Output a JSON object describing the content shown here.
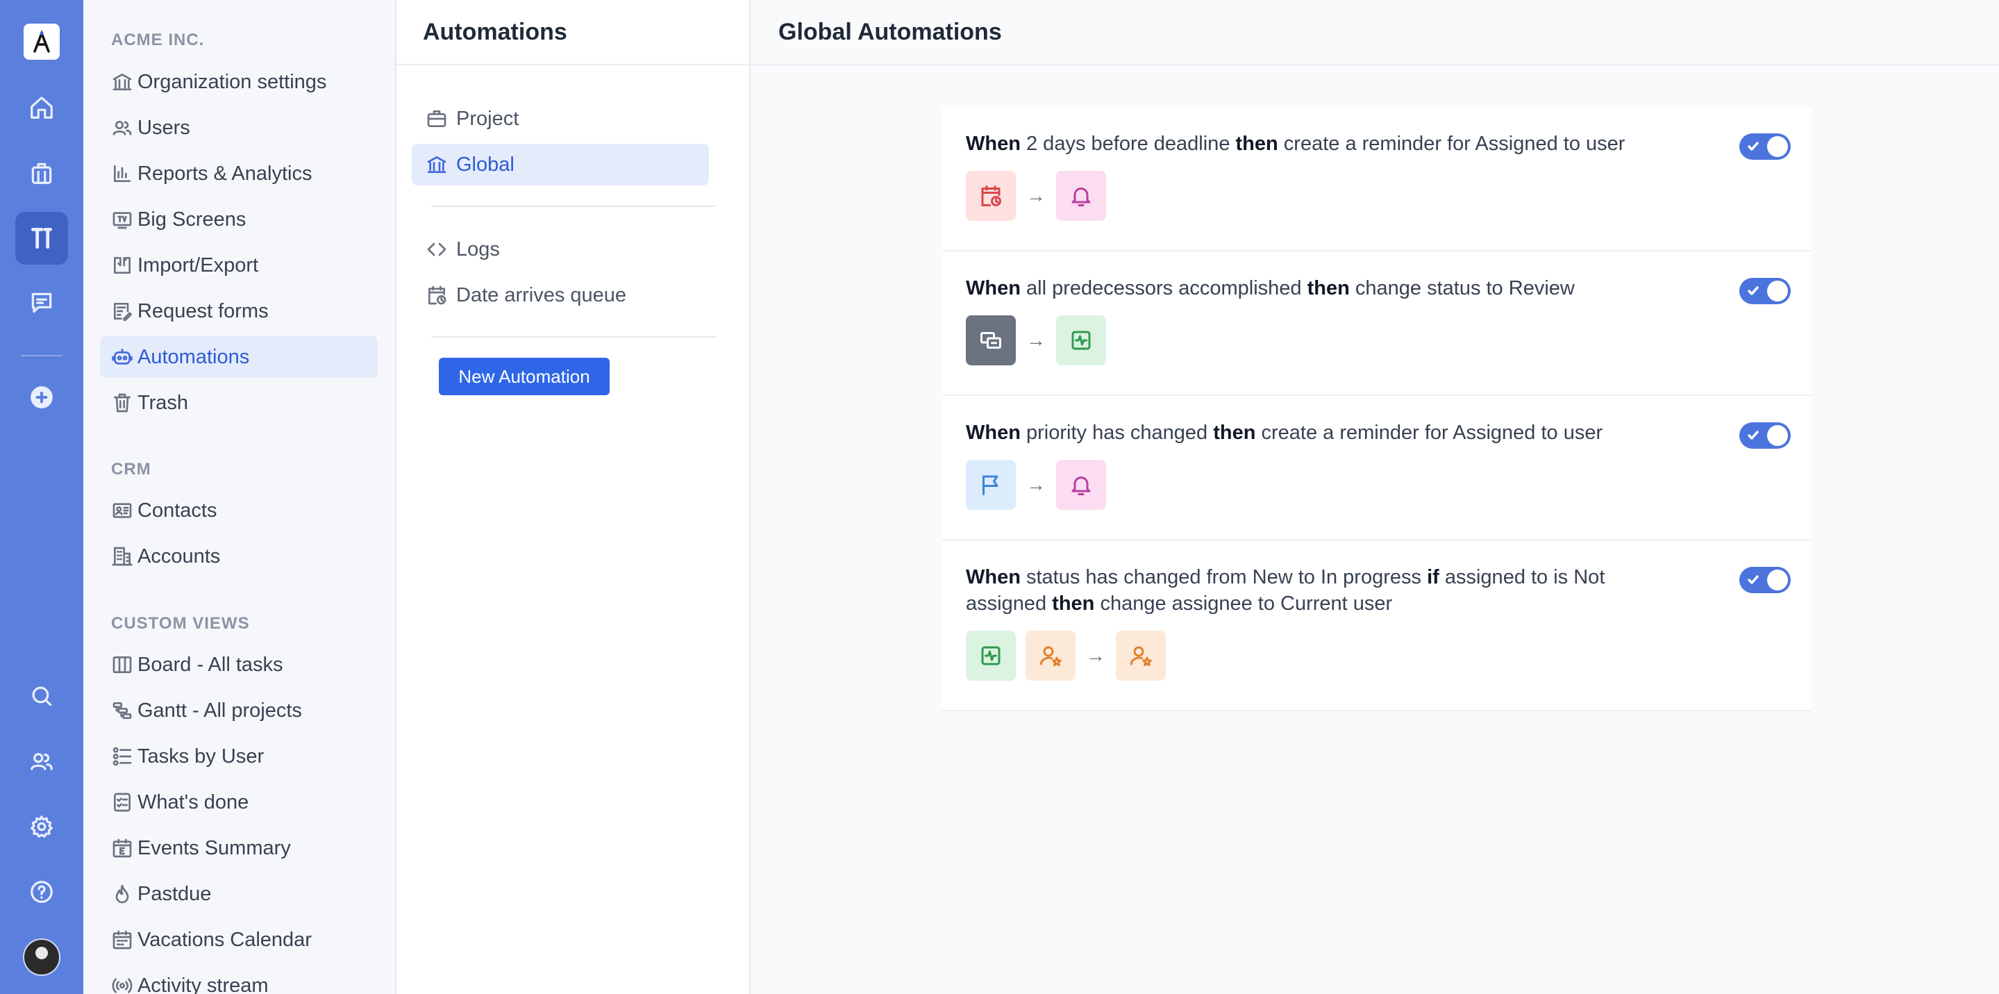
{
  "nav": {
    "section_org": "ACME INC.",
    "org_items": [
      {
        "label": "Organization settings",
        "icon": "bank-icon"
      },
      {
        "label": "Users",
        "icon": "users-icon"
      },
      {
        "label": "Reports & Analytics",
        "icon": "bar-chart-icon"
      },
      {
        "label": "Big Screens",
        "icon": "tv-icon"
      },
      {
        "label": "Import/Export",
        "icon": "import-export-icon"
      },
      {
        "label": "Request forms",
        "icon": "form-icon"
      },
      {
        "label": "Automations",
        "icon": "robot-icon",
        "active": true
      },
      {
        "label": "Trash",
        "icon": "trash-icon"
      }
    ],
    "section_crm": "CRM",
    "crm_items": [
      {
        "label": "Contacts",
        "icon": "contact-card-icon"
      },
      {
        "label": "Accounts",
        "icon": "building-icon"
      }
    ],
    "section_custom": "CUSTOM VIEWS",
    "custom_items": [
      {
        "label": "Board - All tasks",
        "icon": "board-icon"
      },
      {
        "label": "Gantt - All projects",
        "icon": "gantt-icon"
      },
      {
        "label": "Tasks by User",
        "icon": "list-users-icon"
      },
      {
        "label": "What's done",
        "icon": "checklist-icon"
      },
      {
        "label": "Events Summary",
        "icon": "calendar-e-icon"
      },
      {
        "label": "Pastdue",
        "icon": "flame-icon"
      },
      {
        "label": "Vacations Calendar",
        "icon": "calendar-icon"
      },
      {
        "label": "Activity stream",
        "icon": "broadcast-icon"
      }
    ]
  },
  "middle": {
    "title": "Automations",
    "items": [
      {
        "label": "Project",
        "icon": "briefcase-icon"
      },
      {
        "label": "Global",
        "icon": "bank-icon",
        "active": true
      },
      {
        "label": "Logs",
        "icon": "code-icon"
      },
      {
        "label": "Date arrives queue",
        "icon": "calendar-clock-icon"
      }
    ],
    "new_button": "New Automation"
  },
  "main": {
    "title": "Global Automations",
    "rules": [
      {
        "when": "When",
        "trigger": "2 days before deadline",
        "then": "then",
        "action": "create a reminder for Assigned to user",
        "enabled": true,
        "trigger_icons": [
          "calendar-clock-icon"
        ],
        "action_icons": [
          "bell-icon"
        ]
      },
      {
        "when": "When",
        "trigger": "all predecessors accomplished",
        "then": "then",
        "action": "change status to Review",
        "enabled": true,
        "trigger_icons": [
          "predecessors-icon"
        ],
        "action_icons": [
          "status-pulse-icon"
        ]
      },
      {
        "when": "When",
        "trigger": "priority has changed",
        "then": "then",
        "action": "create a reminder for Assigned to user",
        "enabled": true,
        "trigger_icons": [
          "flag-icon"
        ],
        "action_icons": [
          "bell-icon"
        ]
      },
      {
        "when": "When",
        "trigger": "status has changed from New to In progress",
        "if": "if",
        "condition": "assigned to is Not assigned",
        "then": "then",
        "action": "change assignee to Current user",
        "enabled": true,
        "trigger_icons": [
          "status-pulse-icon",
          "user-star-icon"
        ],
        "action_icons": [
          "user-star-icon"
        ]
      }
    ]
  },
  "colors": {
    "rail": "#5b7fdc",
    "accent": "#2f66e8",
    "active_bg": "#e4ebfb",
    "toggle_on": "#4c74dd"
  }
}
